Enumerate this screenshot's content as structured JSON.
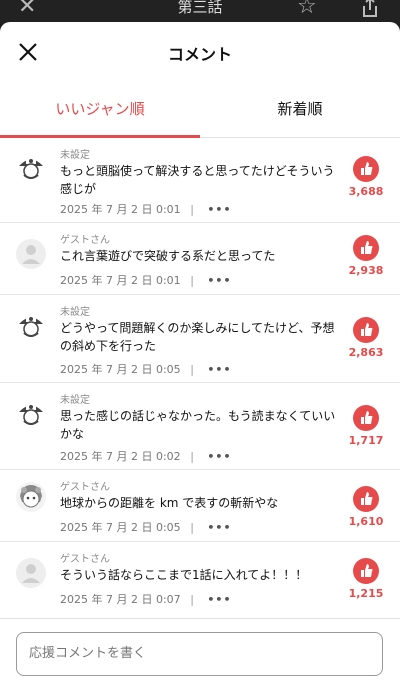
{
  "background_bar": {
    "title": "第三話"
  },
  "header": {
    "title": "コメント"
  },
  "tabs": [
    {
      "label": "いいジャン順",
      "active": true
    },
    {
      "label": "新着順",
      "active": false
    }
  ],
  "comments": [
    {
      "user": "未設定",
      "avatar": "pirate-avatar-icon",
      "text": "もっと頭脳使って解決すると思ってたけどそういう感じが",
      "date": "2025 年 7 月 2 日 0:01",
      "likes": "3,688"
    },
    {
      "user": "ゲストさん",
      "avatar": "default-user-avatar-icon",
      "text": "これ言葉遊びで突破する系だと思ってた",
      "date": "2025 年 7 月 2 日 0:01",
      "likes": "2,938"
    },
    {
      "user": "未設定",
      "avatar": "pirate-avatar-icon",
      "text": "どうやって問題解くのか楽しみにしてたけど、予想の斜め下を行った",
      "date": "2025 年 7 月 2 日 0:05",
      "likes": "2,863"
    },
    {
      "user": "未設定",
      "avatar": "pirate-avatar-icon",
      "text": "思った感じの話じゃなかった。もう読まなくていいかな",
      "date": "2025 年 7 月 2 日 0:02",
      "likes": "1,717"
    },
    {
      "user": "ゲストさん",
      "avatar": "character-avatar-icon",
      "text": "地球からの距離を km で表すの斬新やな",
      "date": "2025 年 7 月 2 日 0:05",
      "likes": "1,610"
    },
    {
      "user": "ゲストさん",
      "avatar": "default-user-avatar-icon",
      "text": "そういう話ならここまで1話に入れてよ！！！",
      "date": "2025 年 7 月 2 日 0:07",
      "likes": "1,215"
    }
  ],
  "input": {
    "placeholder": "応援コメントを書く"
  },
  "colors": {
    "accent": "#e64a4a",
    "text": "#111111",
    "muted": "#8a8a8a"
  }
}
